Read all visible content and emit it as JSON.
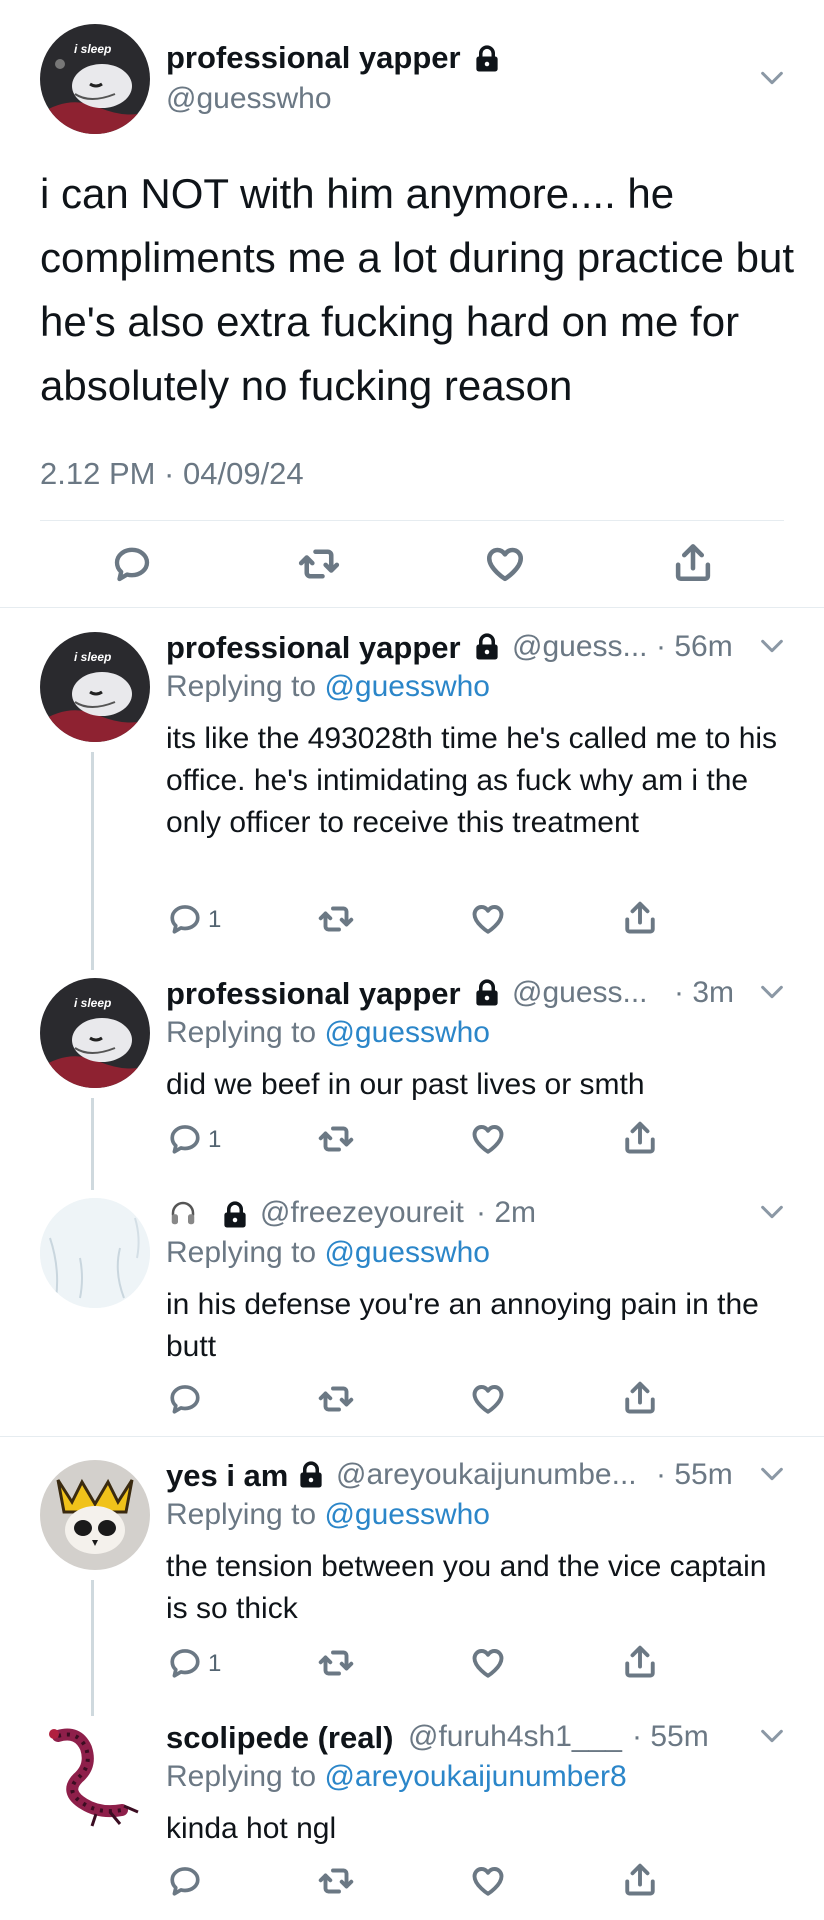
{
  "main_tweet": {
    "display_name": "professional yapper",
    "handle": "@guesswho",
    "text": "i can NOT with him anymore.... he compliments me a lot during practice but he's also extra fucking hard on me for absolutely no fucking reason",
    "timestamp": "2.12 PM · 04/09/24",
    "avatar_label": "i sleep"
  },
  "replies": [
    {
      "display_name": "professional yapper",
      "handle": "@guess...",
      "time": "· 56m",
      "replying_prefix": "Replying to",
      "replying_to": "@guesswho",
      "text": "its like the 493028th time he's called me to his office. he's intimidating as fuck why am i the only officer to receive this treatment",
      "reply_count": "1",
      "avatar_label": "i sleep"
    },
    {
      "display_name": "professional yapper",
      "handle": "@guess...",
      "time": "· 3m",
      "replying_prefix": "Replying to",
      "replying_to": "@guesswho",
      "text": "did we beef in our past lives or smth",
      "reply_count": "1",
      "avatar_label": "i sleep"
    },
    {
      "display_name": "",
      "handle": "@freezeyoureit",
      "time": "· 2m",
      "replying_prefix": "Replying to",
      "replying_to": "@guesswho",
      "text": "in his defense you're an annoying pain in the butt",
      "reply_count": ""
    },
    {
      "display_name": "yes i am",
      "handle": "@areyoukaijunumbe...",
      "time": "· 55m",
      "replying_prefix": "Replying to",
      "replying_to": "@guesswho",
      "text": "the tension between you and the vice captain is so thick",
      "reply_count": "1"
    },
    {
      "display_name": "scolipede (real)",
      "handle": "@furuh4sh1___",
      "time": "· 55m",
      "replying_prefix": "Replying to",
      "replying_to": "@areyoukaijunumber8",
      "text": "kinda hot ngl",
      "reply_count": ""
    }
  ],
  "icons": {
    "lock": "lock-icon",
    "reply": "reply-icon",
    "retweet": "retweet-icon",
    "like": "heart-icon",
    "share": "share-icon",
    "more": "chevron-down-icon",
    "headphones": "headphones-icon"
  },
  "colors": {
    "link": "#2b86c9",
    "muted": "#6b7884",
    "text": "#0f1419",
    "thread_line": "#cfd9de"
  }
}
